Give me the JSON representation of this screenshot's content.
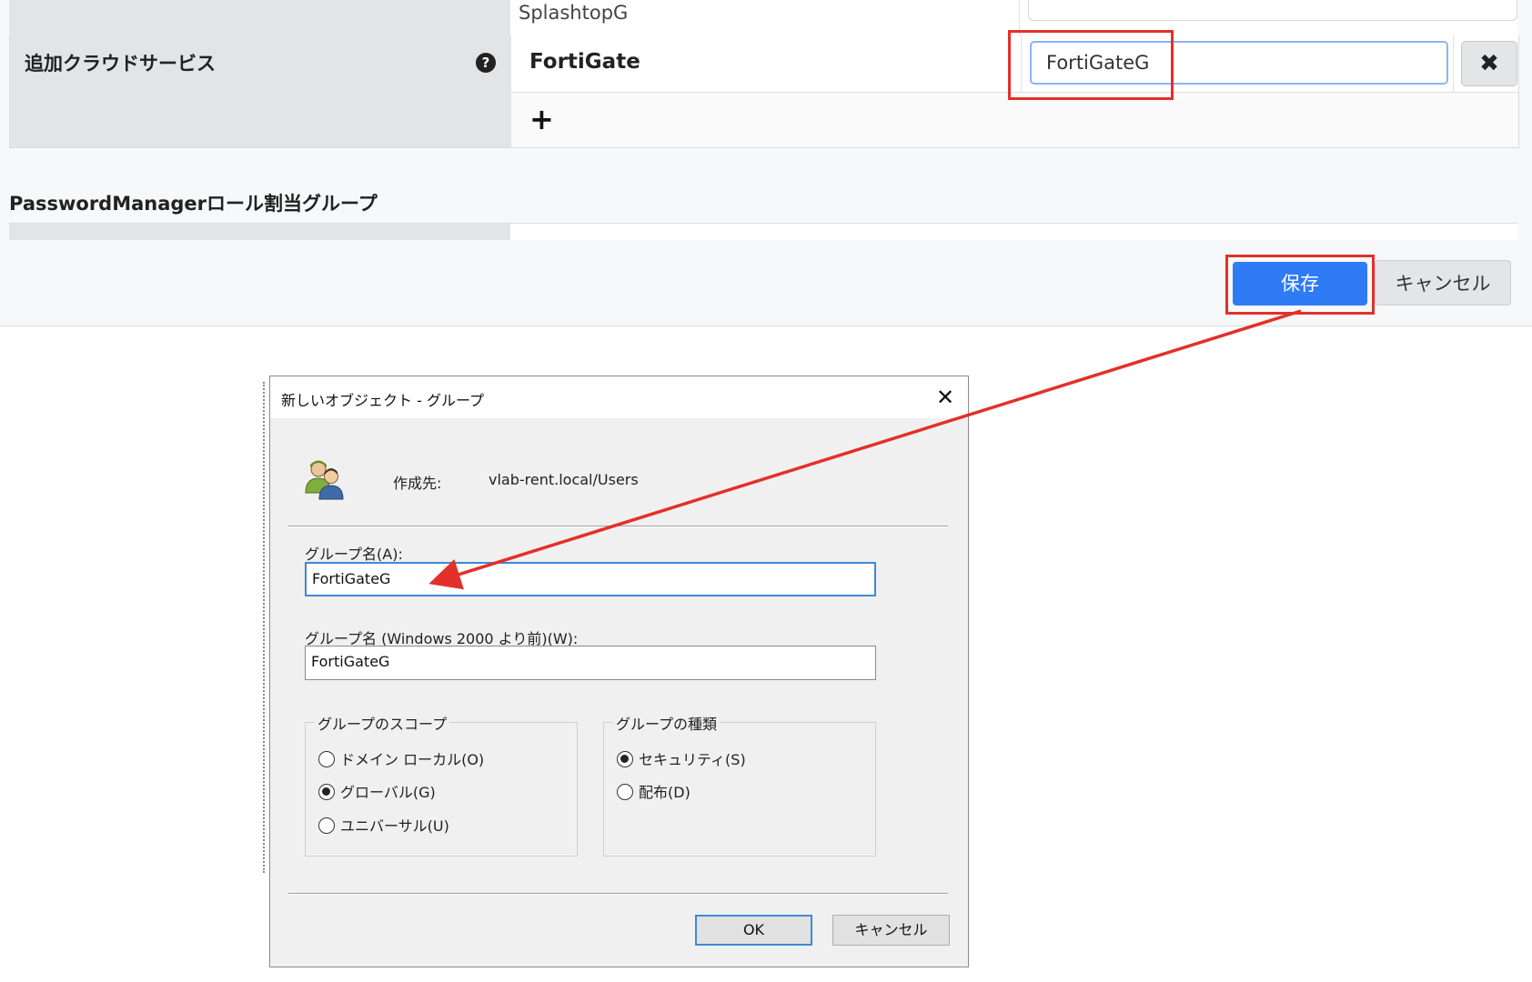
{
  "web_form": {
    "previous_value": "SplashtopG",
    "additional_cloud_service": {
      "label": "追加クラウドサービス",
      "help_icon": "?",
      "service_name": "FortiGate",
      "group_value": "FortiGateG",
      "remove_icon": "✖",
      "add_icon": "+"
    },
    "pm_section_heading": "PasswordManagerロール割当グループ",
    "save_label": "保存",
    "cancel_label": "キャンセル",
    "highlight_color": "#e3302a",
    "primary_color": "#2f7bf5"
  },
  "dialog": {
    "title": "新しいオブジェクト - グループ",
    "close_icon": "✕",
    "group_icon": "users-icon",
    "location_label": "作成先:",
    "location_value": "vlab-rent.local/Users",
    "group_name_label": "グループ名(A):",
    "group_name_value": "FortiGateG",
    "group_name_pre2000_label": "グループ名 (Windows 2000 より前)(W):",
    "group_name_pre2000_value": "FortiGateG",
    "scope": {
      "legend": "グループのスコープ",
      "options": [
        "ドメイン ローカル(O)",
        "グローバル(G)",
        "ユニバーサル(U)"
      ],
      "selected": "グローバル(G)"
    },
    "type": {
      "legend": "グループの種類",
      "options": [
        "セキュリティ(S)",
        "配布(D)"
      ],
      "selected": "セキュリティ(S)"
    },
    "ok_label": "OK",
    "cancel_label": "キャンセル"
  }
}
